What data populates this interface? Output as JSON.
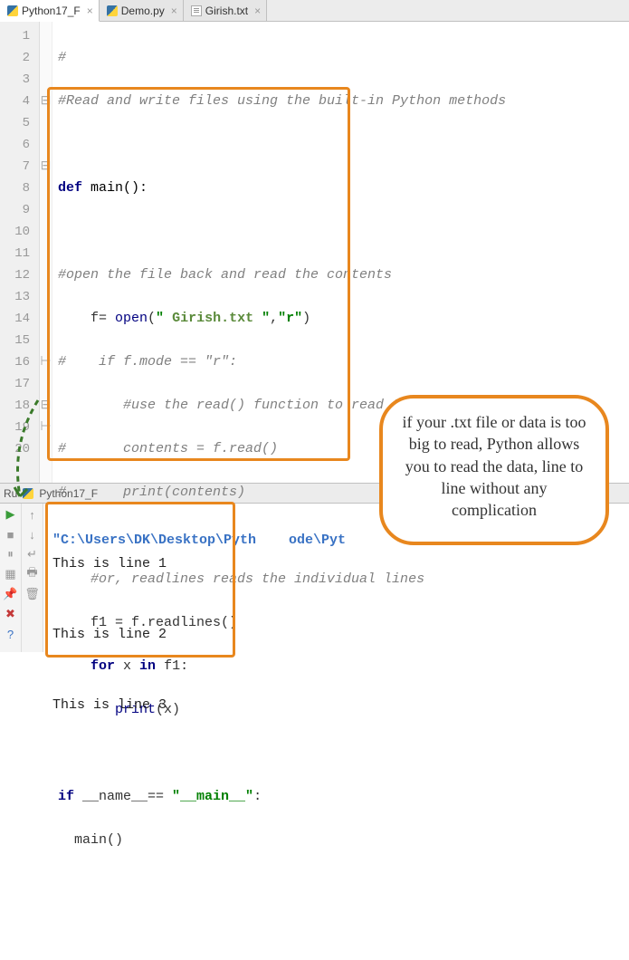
{
  "tabs": [
    {
      "label": "Python17_F",
      "active": true,
      "type": "py"
    },
    {
      "label": "Demo.py",
      "active": false,
      "type": "py"
    },
    {
      "label": "Girish.txt",
      "active": false,
      "type": "txt"
    }
  ],
  "lineNumbers": [
    "1",
    "2",
    "3",
    "4",
    "5",
    "6",
    "7",
    "8",
    "9",
    "10",
    "11",
    "12",
    "13",
    "14",
    "15",
    "16",
    "17",
    "18",
    "19",
    "20"
  ],
  "code": {
    "l1": "#",
    "l2": "#Read and write files using the built-in Python methods",
    "l4_def": "def",
    "l4_fn": " main():",
    "l6": "#open the file back and read the contents",
    "l7_f": "    f= ",
    "l7_open": "open",
    "l7_p1": "(",
    "l7_s1": "\" ",
    "l7_file": "Girish.txt",
    "l7_s2": " \"",
    "l7_c": ",",
    "l7_r": "\"r\"",
    "l7_p2": ")",
    "l8": "#    if f.mode == \"r\":",
    "l9": "        #use the read() function to read the content",
    "l10": "#       contents = f.read()",
    "l11": "#       print(contents)",
    "l13": "    #or, readlines reads the individual lines",
    "l14": "    f1 = f.readlines()",
    "l15_for": "for",
    "l15_mid": " x ",
    "l15_in": "in",
    "l15_end": " f1:",
    "l16_print": "print",
    "l16_arg": "(x)",
    "l18_if": "if",
    "l18_name": " __name__== ",
    "l18_main": "\"__main__\"",
    "l18_colon": ":",
    "l19": "  main()"
  },
  "runTab": {
    "label": "Ru",
    "script": "Python17_F"
  },
  "console": {
    "path": "\"C:\\Users\\DK\\Desktop\\Pyth    ode\\Pyt",
    "out1": "This is line 1",
    "out2": "This is line 2",
    "out3": "This is line 3"
  },
  "callout": "if your .txt file or data is too big to read, Python allows you to read the data, line to line without any complication"
}
